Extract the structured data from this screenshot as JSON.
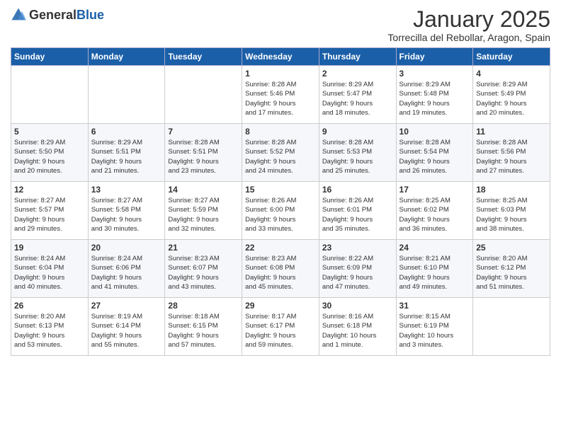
{
  "header": {
    "logo_general": "General",
    "logo_blue": "Blue",
    "month_title": "January 2025",
    "location": "Torrecilla del Rebollar, Aragon, Spain"
  },
  "days_of_week": [
    "Sunday",
    "Monday",
    "Tuesday",
    "Wednesday",
    "Thursday",
    "Friday",
    "Saturday"
  ],
  "weeks": [
    [
      {
        "day": "",
        "info": ""
      },
      {
        "day": "",
        "info": ""
      },
      {
        "day": "",
        "info": ""
      },
      {
        "day": "1",
        "info": "Sunrise: 8:28 AM\nSunset: 5:46 PM\nDaylight: 9 hours\nand 17 minutes."
      },
      {
        "day": "2",
        "info": "Sunrise: 8:29 AM\nSunset: 5:47 PM\nDaylight: 9 hours\nand 18 minutes."
      },
      {
        "day": "3",
        "info": "Sunrise: 8:29 AM\nSunset: 5:48 PM\nDaylight: 9 hours\nand 19 minutes."
      },
      {
        "day": "4",
        "info": "Sunrise: 8:29 AM\nSunset: 5:49 PM\nDaylight: 9 hours\nand 20 minutes."
      }
    ],
    [
      {
        "day": "5",
        "info": "Sunrise: 8:29 AM\nSunset: 5:50 PM\nDaylight: 9 hours\nand 20 minutes."
      },
      {
        "day": "6",
        "info": "Sunrise: 8:29 AM\nSunset: 5:51 PM\nDaylight: 9 hours\nand 21 minutes."
      },
      {
        "day": "7",
        "info": "Sunrise: 8:28 AM\nSunset: 5:51 PM\nDaylight: 9 hours\nand 23 minutes."
      },
      {
        "day": "8",
        "info": "Sunrise: 8:28 AM\nSunset: 5:52 PM\nDaylight: 9 hours\nand 24 minutes."
      },
      {
        "day": "9",
        "info": "Sunrise: 8:28 AM\nSunset: 5:53 PM\nDaylight: 9 hours\nand 25 minutes."
      },
      {
        "day": "10",
        "info": "Sunrise: 8:28 AM\nSunset: 5:54 PM\nDaylight: 9 hours\nand 26 minutes."
      },
      {
        "day": "11",
        "info": "Sunrise: 8:28 AM\nSunset: 5:56 PM\nDaylight: 9 hours\nand 27 minutes."
      }
    ],
    [
      {
        "day": "12",
        "info": "Sunrise: 8:27 AM\nSunset: 5:57 PM\nDaylight: 9 hours\nand 29 minutes."
      },
      {
        "day": "13",
        "info": "Sunrise: 8:27 AM\nSunset: 5:58 PM\nDaylight: 9 hours\nand 30 minutes."
      },
      {
        "day": "14",
        "info": "Sunrise: 8:27 AM\nSunset: 5:59 PM\nDaylight: 9 hours\nand 32 minutes."
      },
      {
        "day": "15",
        "info": "Sunrise: 8:26 AM\nSunset: 6:00 PM\nDaylight: 9 hours\nand 33 minutes."
      },
      {
        "day": "16",
        "info": "Sunrise: 8:26 AM\nSunset: 6:01 PM\nDaylight: 9 hours\nand 35 minutes."
      },
      {
        "day": "17",
        "info": "Sunrise: 8:25 AM\nSunset: 6:02 PM\nDaylight: 9 hours\nand 36 minutes."
      },
      {
        "day": "18",
        "info": "Sunrise: 8:25 AM\nSunset: 6:03 PM\nDaylight: 9 hours\nand 38 minutes."
      }
    ],
    [
      {
        "day": "19",
        "info": "Sunrise: 8:24 AM\nSunset: 6:04 PM\nDaylight: 9 hours\nand 40 minutes."
      },
      {
        "day": "20",
        "info": "Sunrise: 8:24 AM\nSunset: 6:06 PM\nDaylight: 9 hours\nand 41 minutes."
      },
      {
        "day": "21",
        "info": "Sunrise: 8:23 AM\nSunset: 6:07 PM\nDaylight: 9 hours\nand 43 minutes."
      },
      {
        "day": "22",
        "info": "Sunrise: 8:23 AM\nSunset: 6:08 PM\nDaylight: 9 hours\nand 45 minutes."
      },
      {
        "day": "23",
        "info": "Sunrise: 8:22 AM\nSunset: 6:09 PM\nDaylight: 9 hours\nand 47 minutes."
      },
      {
        "day": "24",
        "info": "Sunrise: 8:21 AM\nSunset: 6:10 PM\nDaylight: 9 hours\nand 49 minutes."
      },
      {
        "day": "25",
        "info": "Sunrise: 8:20 AM\nSunset: 6:12 PM\nDaylight: 9 hours\nand 51 minutes."
      }
    ],
    [
      {
        "day": "26",
        "info": "Sunrise: 8:20 AM\nSunset: 6:13 PM\nDaylight: 9 hours\nand 53 minutes."
      },
      {
        "day": "27",
        "info": "Sunrise: 8:19 AM\nSunset: 6:14 PM\nDaylight: 9 hours\nand 55 minutes."
      },
      {
        "day": "28",
        "info": "Sunrise: 8:18 AM\nSunset: 6:15 PM\nDaylight: 9 hours\nand 57 minutes."
      },
      {
        "day": "29",
        "info": "Sunrise: 8:17 AM\nSunset: 6:17 PM\nDaylight: 9 hours\nand 59 minutes."
      },
      {
        "day": "30",
        "info": "Sunrise: 8:16 AM\nSunset: 6:18 PM\nDaylight: 10 hours\nand 1 minute."
      },
      {
        "day": "31",
        "info": "Sunrise: 8:15 AM\nSunset: 6:19 PM\nDaylight: 10 hours\nand 3 minutes."
      },
      {
        "day": "",
        "info": ""
      }
    ]
  ]
}
